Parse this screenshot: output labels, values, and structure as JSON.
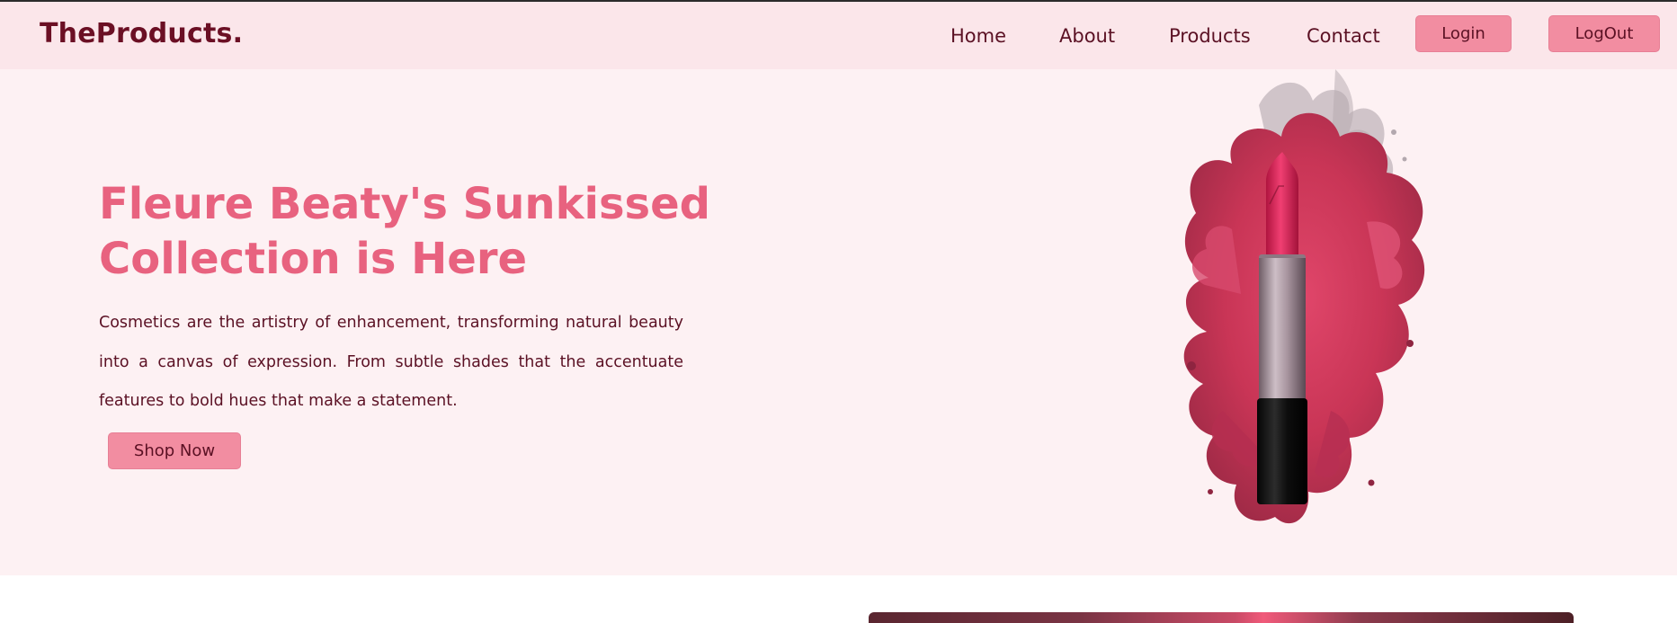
{
  "brand": {
    "name": "TheProducts."
  },
  "nav": {
    "links": [
      "Home",
      "About",
      "Products",
      "Contact"
    ],
    "login_label": "Login",
    "logout_label": "LogOut"
  },
  "hero": {
    "title": "Fleure Beaty's Sunkissed Collection is Here",
    "description": "Cosmetics are the artistry of enhancement, transforming natural beauty into a canvas of expression. From subtle shades that the accentuate features to bold hues that make a statement.",
    "cta_label": "Shop Now",
    "image_icon": "lipstick-splash-image"
  },
  "colors": {
    "navbar_bg": "#fbe6ea",
    "hero_bg": "#fdf1f3",
    "brand": "#6b0f24",
    "accent": "#e8627f",
    "button_bg": "#f28da1"
  }
}
